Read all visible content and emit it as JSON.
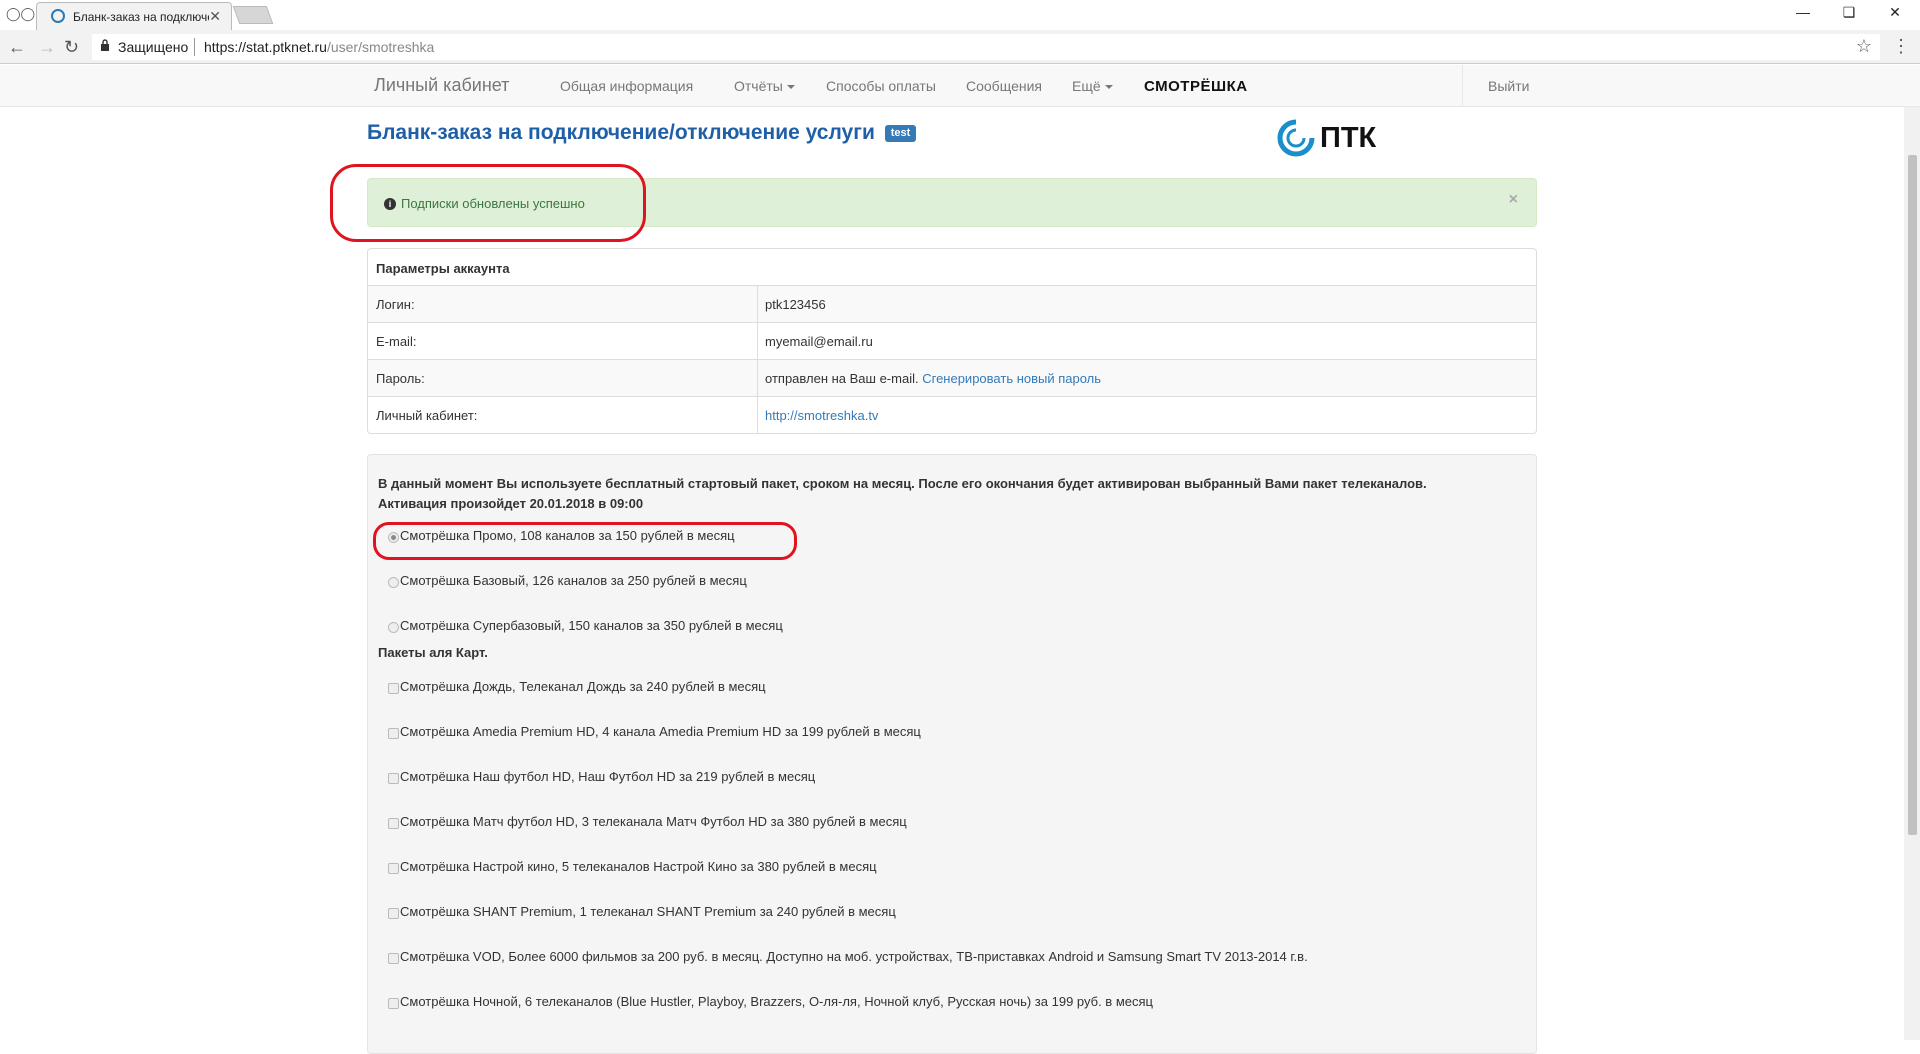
{
  "browser": {
    "tab_title": "Бланк-заказ на подключение",
    "secure_label": "Защищено",
    "url_host": "https://stat.ptknet.ru",
    "url_path": "/user/smotreshka"
  },
  "navbar": {
    "brand": "Личный кабинет",
    "links": [
      "Общая информация",
      "Отчёты",
      "Способы оплаты",
      "Сообщения",
      "Ещё"
    ],
    "partner_logo": "СМОТРЁШКА",
    "logout": "Выйти"
  },
  "page": {
    "title": "Бланк-заказ на подключение/отключение услуги",
    "badge": "test",
    "logo_text": "ПТК"
  },
  "alert": {
    "message": "Подписки обновлены успешно",
    "close": "×"
  },
  "account": {
    "heading": "Параметры аккаунта",
    "rows": [
      {
        "key": "Логин:",
        "value": "ptk123456"
      },
      {
        "key": "E-mail:",
        "value": "myemail@email.ru"
      },
      {
        "key": "Пароль:",
        "value": "отправлен на Ваш e-mail.",
        "link": "Сгенерировать новый пароль"
      },
      {
        "key": "Личный кабинет:",
        "link": "http://smotreshka.tv"
      }
    ]
  },
  "packages": {
    "notice_line1": "В данный момент Вы используете бесплатный стартовый пакет, сроком на месяц. После его окончания будет активирован выбранный Вами пакет телеканалов.",
    "notice_line2": "Активация произойдет 20.01.2018 в 09:00",
    "base_options": [
      {
        "label": "Смотрёшка Промо, 108 каналов за 150 рублей в месяц",
        "checked": true
      },
      {
        "label": "Смотрёшка Базовый, 126 каналов за 250 рублей в месяц",
        "checked": false
      },
      {
        "label": "Смотрёшка Супербазовый, 150 каналов за 350 рублей в месяц",
        "checked": false
      }
    ],
    "addons_label": "Пакеты аля Карт.",
    "addons": [
      "Смотрёшка Дождь, Телеканал Дождь за 240 рублей в месяц",
      "Смотрёшка Amedia Premium HD, 4 канала Amedia Premium HD за 199 рублей в месяц",
      "Смотрёшка Наш футбол HD, Наш Футбол HD за 219 рублей в месяц",
      "Смотрёшка Матч футбол HD, 3 телеканала Матч Футбол HD за 380 рублей в месяц",
      "Смотрёшка Настрой кино, 5 телеканалов Настрой Кино за 380 рублей в месяц",
      "Смотрёшка SHANT Premium, 1 телеканал SHANT Premium за 240 рублей в месяц",
      "Смотрёшка VOD, Более 6000 фильмов за 200 руб. в месяц. Доступно на моб. устройствах, ТВ-приставках Android и Samsung Smart TV 2013-2014 г.в.",
      "Смотрёшка Ночной, 6 телеканалов (Blue Hustler, Playboy, Brazzers, О-ля-ля, Ночной клуб, Русская ночь) за 199 руб. в месяц"
    ]
  }
}
